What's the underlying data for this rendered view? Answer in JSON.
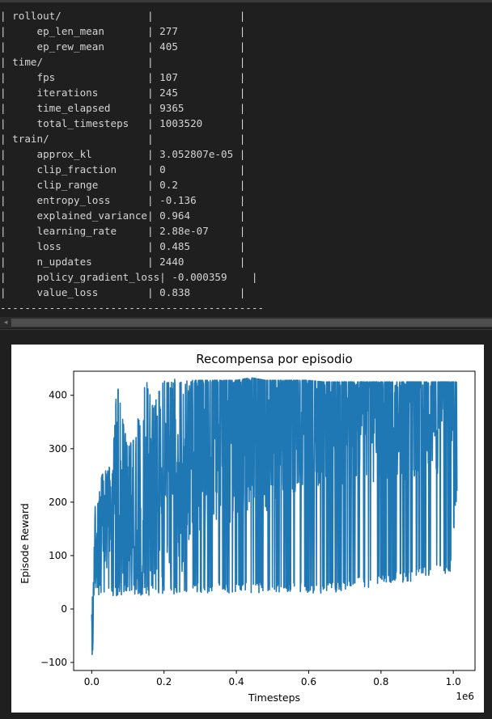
{
  "log": {
    "rows": [
      {
        "key": "rollout/",
        "indent": false,
        "value": ""
      },
      {
        "key": "ep_len_mean",
        "indent": true,
        "value": "277"
      },
      {
        "key": "ep_rew_mean",
        "indent": true,
        "value": "405"
      },
      {
        "key": "time/",
        "indent": false,
        "value": ""
      },
      {
        "key": "fps",
        "indent": true,
        "value": "107"
      },
      {
        "key": "iterations",
        "indent": true,
        "value": "245"
      },
      {
        "key": "time_elapsed",
        "indent": true,
        "value": "9365"
      },
      {
        "key": "total_timesteps",
        "indent": true,
        "value": "1003520"
      },
      {
        "key": "train/",
        "indent": false,
        "value": ""
      },
      {
        "key": "approx_kl",
        "indent": true,
        "value": "3.052807e-05"
      },
      {
        "key": "clip_fraction",
        "indent": true,
        "value": "0"
      },
      {
        "key": "clip_range",
        "indent": true,
        "value": "0.2"
      },
      {
        "key": "entropy_loss",
        "indent": true,
        "value": "-0.136"
      },
      {
        "key": "explained_variance",
        "indent": true,
        "value": "0.964"
      },
      {
        "key": "learning_rate",
        "indent": true,
        "value": "2.88e-07"
      },
      {
        "key": "loss",
        "indent": true,
        "value": "0.485"
      },
      {
        "key": "n_updates",
        "indent": true,
        "value": "2440"
      },
      {
        "key": "policy_gradient_loss",
        "indent": true,
        "value": "-0.000359"
      },
      {
        "key": "value_loss",
        "indent": true,
        "value": "0.838"
      }
    ],
    "footer_dashes": "-------------------------------------------"
  },
  "scrollbar": {
    "left_arrow": "◂"
  },
  "chart_data": {
    "type": "line",
    "title": "Recompensa por episodio",
    "xlabel": "Timesteps",
    "ylabel": "Episode Reward",
    "x_offset_label": "1e6",
    "xlim": [
      -0.05,
      1.06
    ],
    "ylim": [
      -115,
      445
    ],
    "xticks": [
      0.0,
      0.2,
      0.4,
      0.6,
      0.8,
      1.0
    ],
    "xtick_labels": [
      "0.0",
      "0.2",
      "0.4",
      "0.6",
      "0.8",
      "1.0"
    ],
    "yticks": [
      -100,
      0,
      100,
      200,
      300,
      400
    ],
    "ytick_labels": [
      "−100",
      "0",
      "100",
      "200",
      "300",
      "400"
    ],
    "grid": false,
    "line_color": "#1f77b4",
    "series": [
      {
        "x_1e6": [
          0.0,
          0.003,
          0.005,
          0.007,
          0.01,
          0.015,
          0.02,
          0.03,
          0.045,
          0.06,
          0.07,
          0.08,
          0.1,
          0.12,
          0.15,
          0.17,
          0.2,
          0.22,
          0.25,
          0.28,
          0.3,
          0.33,
          0.36,
          0.4,
          0.44,
          0.48,
          0.52,
          0.56,
          0.6,
          0.64,
          0.68,
          0.72,
          0.76,
          0.8,
          0.84,
          0.88,
          0.92,
          0.96,
          0.99,
          1.01
        ],
        "y_typical": [
          -10,
          -85,
          50,
          100,
          130,
          120,
          140,
          160,
          150,
          170,
          180,
          160,
          190,
          200,
          210,
          200,
          230,
          260,
          250,
          300,
          320,
          340,
          330,
          350,
          370,
          360,
          380,
          390,
          380,
          400,
          395,
          400,
          405,
          400,
          410,
          405,
          415,
          410,
          420,
          420
        ],
        "y_min": [
          -10,
          -85,
          25,
          25,
          25,
          25,
          25,
          25,
          25,
          25,
          25,
          25,
          25,
          25,
          25,
          25,
          25,
          25,
          25,
          30,
          30,
          30,
          30,
          30,
          30,
          30,
          30,
          30,
          30,
          30,
          30,
          40,
          40,
          45,
          50,
          50,
          60,
          65,
          60,
          210
        ],
        "y_max": [
          -10,
          50,
          195,
          200,
          190,
          210,
          220,
          260,
          260,
          300,
          428,
          380,
          300,
          330,
          431,
          380,
          433,
          430,
          430,
          428,
          428,
          428,
          428,
          428,
          433,
          428,
          428,
          428,
          428,
          425,
          425,
          425,
          425,
          425,
          425,
          425,
          425,
          425,
          425,
          425
        ]
      }
    ]
  }
}
